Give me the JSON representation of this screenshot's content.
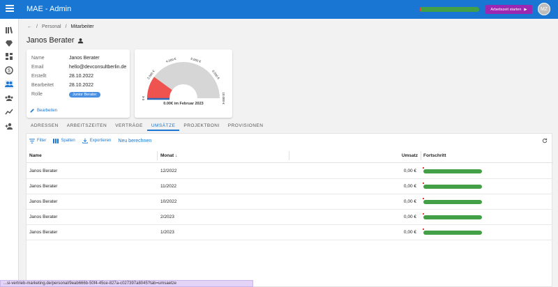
{
  "app": {
    "title": "MAE - Admin",
    "start_button": "Arbeitszeit starten",
    "avatar_initials": "MZ",
    "timer_progress": 0.0
  },
  "breadcrumb": {
    "level1": "Personal",
    "current": "Mitarbeiter"
  },
  "page": {
    "title": "Janos Berater"
  },
  "info": {
    "name_label": "Name",
    "name": "Janos Berater",
    "email_label": "Email",
    "email": "hello@devconsultberlin.de",
    "created_label": "Erstellt",
    "created": "28.10.2022",
    "edited_label": "Bearbeitet",
    "edited": "28.10.2022",
    "role_label": "Rolle",
    "role": "Junior Berater",
    "edit_button": "Bearbeiten"
  },
  "gauge": {
    "ticks": [
      "0 €",
      "2.000 €",
      "4.000 €",
      "6.000 €",
      "8.000 €",
      "10.000 €"
    ],
    "caption": "0.00€ im Februar 2023",
    "value": 0,
    "target": 2000,
    "max": 10000
  },
  "tabs": [
    "ADRESSEN",
    "ARBEITSZEITEN",
    "VERTRÄGE",
    "UMSÄTZE",
    "PROJEKTBONI",
    "PROVISIONEN"
  ],
  "active_tab": 3,
  "toolbar": {
    "filter": "Filter",
    "columns": "Spalten",
    "export": "Exportieren",
    "recalc": "Neu berechnen"
  },
  "table": {
    "headers": {
      "name": "Name",
      "month": "Monat",
      "revenue": "Umsatz",
      "progress": "Fortschritt"
    },
    "rows": [
      {
        "name": "Janos Berater",
        "month": "12/2022",
        "revenue": "0,00 €",
        "progress": 0.0
      },
      {
        "name": "Janos Berater",
        "month": "11/2022",
        "revenue": "0,00 €",
        "progress": 0.0
      },
      {
        "name": "Janos Berater",
        "month": "10/2022",
        "revenue": "0,00 €",
        "progress": 0.0
      },
      {
        "name": "Janos Berater",
        "month": "2/2023",
        "revenue": "0,00 €",
        "progress": 0.0
      },
      {
        "name": "Janos Berater",
        "month": "1/2023",
        "revenue": "0,00 €",
        "progress": 0.0
      }
    ]
  },
  "status_url": "...si-vertrieb-marketing.de/personal/9eab666b-50f4-45ce-827a-c027397a8045?tab=umsaetze",
  "colors": {
    "primary": "#1976d2",
    "accent": "#9c27b0",
    "danger": "#e53935",
    "success": "#43a047",
    "role": "#4a90e2"
  }
}
